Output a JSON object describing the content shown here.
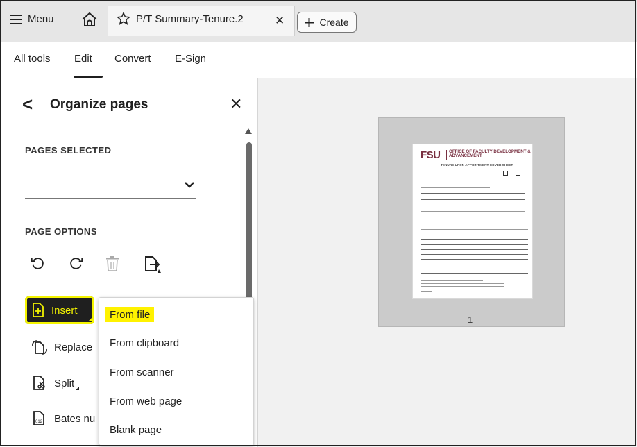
{
  "topbar": {
    "menu_label": "Menu",
    "tab_title": "P/T Summary-Tenure.2",
    "create_label": "Create",
    "icons": [
      "hamburger-icon",
      "home-icon",
      "star-icon",
      "close-icon",
      "plus-icon"
    ]
  },
  "nav": {
    "tabs": [
      "All tools",
      "Edit",
      "Convert",
      "E-Sign"
    ],
    "active_tab": "Edit"
  },
  "panel": {
    "title": "Organize pages",
    "pages_selected_label": "PAGES SELECTED",
    "page_options_label": "PAGE OPTIONS",
    "option_icons": [
      "rotate-left-icon",
      "rotate-right-icon",
      "delete-icon",
      "extract-icon"
    ],
    "items": {
      "insert": "Insert",
      "replace": "Replace",
      "split": "Split",
      "bates": "Bates nu"
    }
  },
  "insert_menu": {
    "items": [
      "From file",
      "From clipboard",
      "From scanner",
      "From web page",
      "Blank page"
    ],
    "highlighted": "From file"
  },
  "document": {
    "page_number": "1",
    "logo": "FSU",
    "office": "OFFICE OF FACULTY DEVELOPMENT & ADVANCEMENT",
    "subtitle": "TENURE UPON APPOINTMENT COVER SHEET"
  },
  "colors": {
    "highlight": "#fff200",
    "fsu_garnet": "#782f40",
    "insert_bg": "#1f1f1f"
  }
}
